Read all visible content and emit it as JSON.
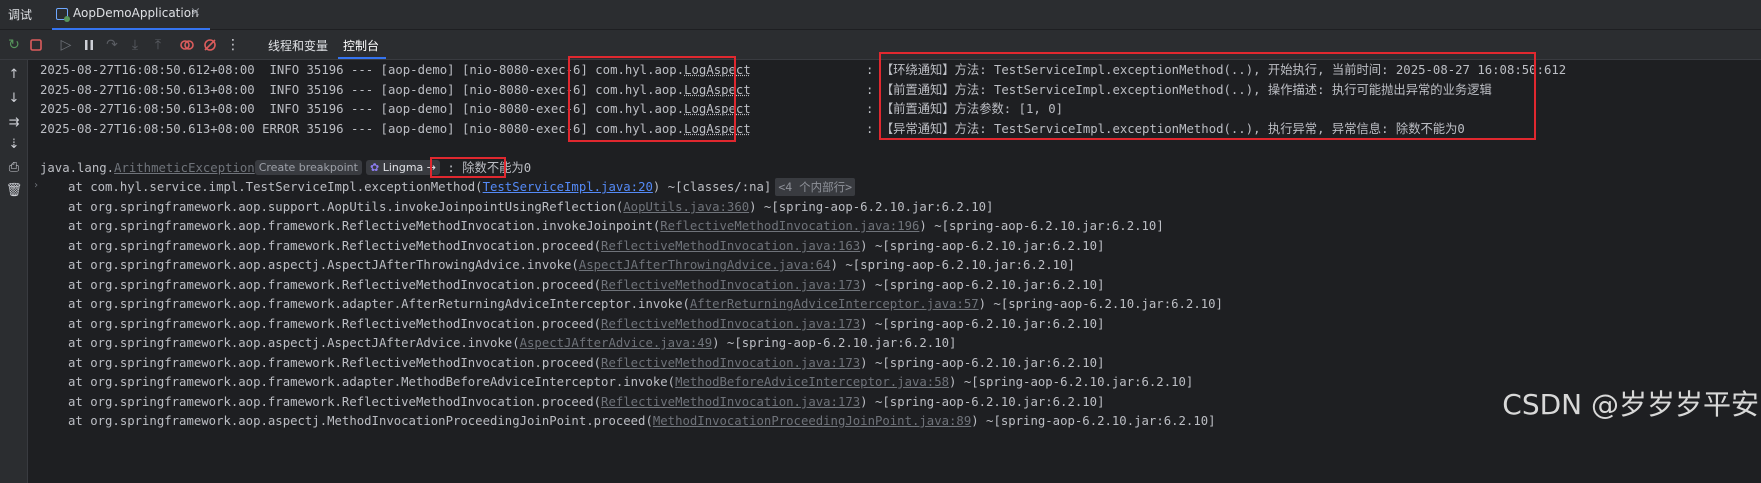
{
  "tabbar": {
    "title": "调试",
    "run_tab_label": "AopDemoApplication",
    "close_glyph": "×"
  },
  "toolbar": {
    "subtabs": [
      {
        "label": "线程和变量"
      },
      {
        "label": "控制台"
      }
    ],
    "icons": [
      "rerun-icon",
      "stop-icon",
      "resume-icon",
      "pause-icon",
      "step-over-icon",
      "step-into-icon",
      "step-out-icon",
      "view-breakpoints-icon",
      "mute-breakpoints-icon",
      "more-icon"
    ],
    "accent": "#3574f0"
  },
  "sidebar": {
    "icons": [
      "up-arrow-icon",
      "down-arrow-icon",
      "soft-wrap-icon",
      "scroll-to-end-icon",
      "print-icon",
      "trash-icon"
    ]
  },
  "console": {
    "log_lines": [
      {
        "prefix": "2025-08-27T16:08:50.612+08:00  INFO 35196 --- [aop-demo] [nio-8080-exec-6] ",
        "logger_pkg": "com.hyl.aop.",
        "logger_cls": "LogAspect",
        "message": "【环绕通知】方法: TestServiceImpl.exceptionMethod(..), 开始执行, 当前时间: 2025-08-27 16:08:50:612"
      },
      {
        "prefix": "2025-08-27T16:08:50.613+08:00  INFO 35196 --- [aop-demo] [nio-8080-exec-6] ",
        "logger_pkg": "com.hyl.aop.",
        "logger_cls": "LogAspect",
        "message": "【前置通知】方法: TestServiceImpl.exceptionMethod(..), 操作描述: 执行可能抛出异常的业务逻辑"
      },
      {
        "prefix": "2025-08-27T16:08:50.613+08:00  INFO 35196 --- [aop-demo] [nio-8080-exec-6] ",
        "logger_pkg": "com.hyl.aop.",
        "logger_cls": "LogAspect",
        "message": "【前置通知】方法参数: [1, 0]"
      },
      {
        "prefix": "2025-08-27T16:08:50.613+08:00 ERROR 35196 --- [aop-demo] [nio-8080-exec-6] ",
        "logger_pkg": "com.hyl.aop.",
        "logger_cls": "LogAspect",
        "message": "【异常通知】方法: TestServiceImpl.exceptionMethod(..), 执行异常, 异常信息: 除数不能为0"
      }
    ],
    "separator": ": ",
    "exception": {
      "pkg": "java.lang.",
      "cls": "ArithmeticException",
      "create_breakpoint": "Create breakpoint",
      "lingma": "Lingma",
      "lingma_arrow": "→",
      "colon": ":",
      "message": "除数不能为0"
    },
    "stack": [
      {
        "text": "at com.hyl.service.impl.TestServiceImpl.exceptionMethod(",
        "link": "TestServiceImpl.java:20",
        "suffix": ") ~[classes/:na]",
        "fold": "<4 个内部行>",
        "primary": true
      },
      {
        "text": "at org.springframework.aop.support.AopUtils.invokeJoinpointUsingReflection(",
        "link": "AopUtils.java:360",
        "suffix": ") ~[spring-aop-6.2.10.jar:6.2.10]"
      },
      {
        "text": "at org.springframework.aop.framework.ReflectiveMethodInvocation.invokeJoinpoint(",
        "link": "ReflectiveMethodInvocation.java:196",
        "suffix": ") ~[spring-aop-6.2.10.jar:6.2.10]"
      },
      {
        "text": "at org.springframework.aop.framework.ReflectiveMethodInvocation.proceed(",
        "link": "ReflectiveMethodInvocation.java:163",
        "suffix": ") ~[spring-aop-6.2.10.jar:6.2.10]"
      },
      {
        "text": "at org.springframework.aop.aspectj.AspectJAfterThrowingAdvice.invoke(",
        "link": "AspectJAfterThrowingAdvice.java:64",
        "suffix": ") ~[spring-aop-6.2.10.jar:6.2.10]"
      },
      {
        "text": "at org.springframework.aop.framework.ReflectiveMethodInvocation.proceed(",
        "link": "ReflectiveMethodInvocation.java:173",
        "suffix": ") ~[spring-aop-6.2.10.jar:6.2.10]"
      },
      {
        "text": "at org.springframework.aop.framework.adapter.AfterReturningAdviceInterceptor.invoke(",
        "link": "AfterReturningAdviceInterceptor.java:57",
        "suffix": ") ~[spring-aop-6.2.10.jar:6.2.10]"
      },
      {
        "text": "at org.springframework.aop.framework.ReflectiveMethodInvocation.proceed(",
        "link": "ReflectiveMethodInvocation.java:173",
        "suffix": ") ~[spring-aop-6.2.10.jar:6.2.10]"
      },
      {
        "text": "at org.springframework.aop.aspectj.AspectJAfterAdvice.invoke(",
        "link": "AspectJAfterAdvice.java:49",
        "suffix": ") ~[spring-aop-6.2.10.jar:6.2.10]"
      },
      {
        "text": "at org.springframework.aop.framework.ReflectiveMethodInvocation.proceed(",
        "link": "ReflectiveMethodInvocation.java:173",
        "suffix": ") ~[spring-aop-6.2.10.jar:6.2.10]"
      },
      {
        "text": "at org.springframework.aop.framework.adapter.MethodBeforeAdviceInterceptor.invoke(",
        "link": "MethodBeforeAdviceInterceptor.java:58",
        "suffix": ") ~[spring-aop-6.2.10.jar:6.2.10]"
      },
      {
        "text": "at org.springframework.aop.framework.ReflectiveMethodInvocation.proceed(",
        "link": "ReflectiveMethodInvocation.java:173",
        "suffix": ") ~[spring-aop-6.2.10.jar:6.2.10]"
      },
      {
        "text": "at org.springframework.aop.aspectj.MethodInvocationProceedingJoinPoint.proceed(",
        "link": "MethodInvocationProceedingJoinPoint.java:89",
        "suffix": ") ~[spring-aop-6.2.10.jar:6.2.10]"
      }
    ],
    "highlight_color": "#e0282f"
  },
  "watermark": "CSDN @岁岁岁平安"
}
